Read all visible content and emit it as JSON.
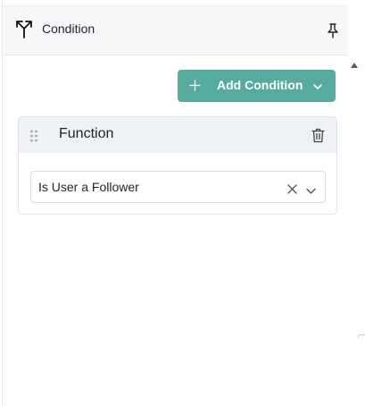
{
  "panel": {
    "title": "Condition",
    "icon": "split-arrow-icon",
    "pin_icon": "pin-icon"
  },
  "toolbar": {
    "add_label": "Add Condition",
    "plus_icon": "plus-icon",
    "caret_icon": "chevron-down-icon",
    "accent": "#55ab9d"
  },
  "condition_card": {
    "title": "Function",
    "drag_icon": "drag-handle-icon",
    "delete_icon": "trash-icon",
    "function_select": {
      "value": "Is User a Follower",
      "clear_icon": "close-icon",
      "chevron_icon": "chevron-down-icon"
    }
  }
}
